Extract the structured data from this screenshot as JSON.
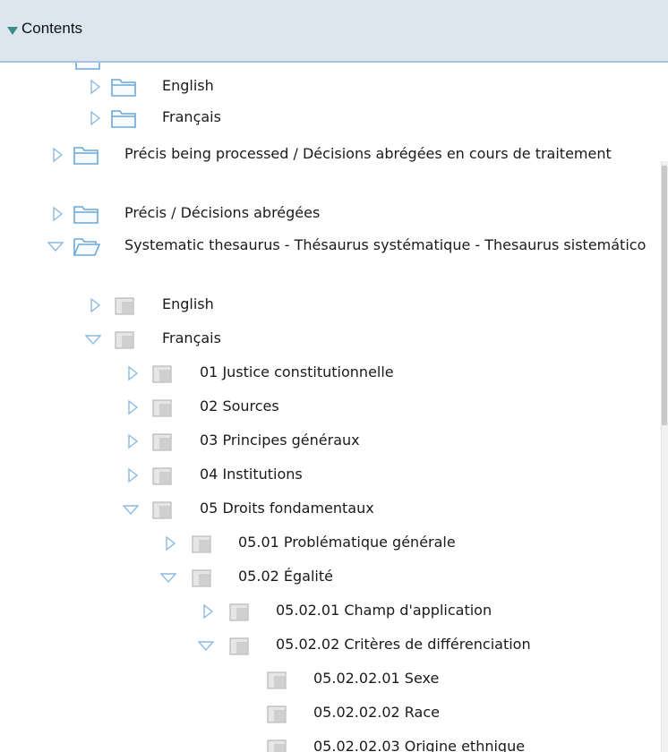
{
  "header": {
    "title": "Contents"
  },
  "tree": {
    "english_1": "English",
    "francais_1": "Français",
    "precis_processing": "Précis being processed / Décisions abrégées en cours de traitement",
    "precis": "Précis / Décisions abrégées",
    "thesaurus": "Systematic thesaurus - Thésaurus systématique - Thesaurus sistemático",
    "english_2": "English",
    "francais_2": "Français",
    "n01": "01 Justice constitutionnelle",
    "n02": "02 Sources",
    "n03": "03 Principes généraux",
    "n04": "04 Institutions",
    "n05": "05 Droits fondamentaux",
    "n0501": "05.01 Problématique générale",
    "n0502": "05.02 Égalité",
    "n050201": "05.02.01 Champ d'application",
    "n050202": "05.02.02 Critères de différenciation",
    "n05020201": "05.02.02.01 Sexe",
    "n05020202": "05.02.02.02 Race",
    "n05020203": "05.02.02.03 Origine ethnique"
  },
  "colors": {
    "header_bg": "#dce6ef",
    "header_border": "#a6c3de",
    "chevron": "#7fb3e0",
    "folder": "#6aa8d8",
    "page": "#b8b8b8"
  }
}
